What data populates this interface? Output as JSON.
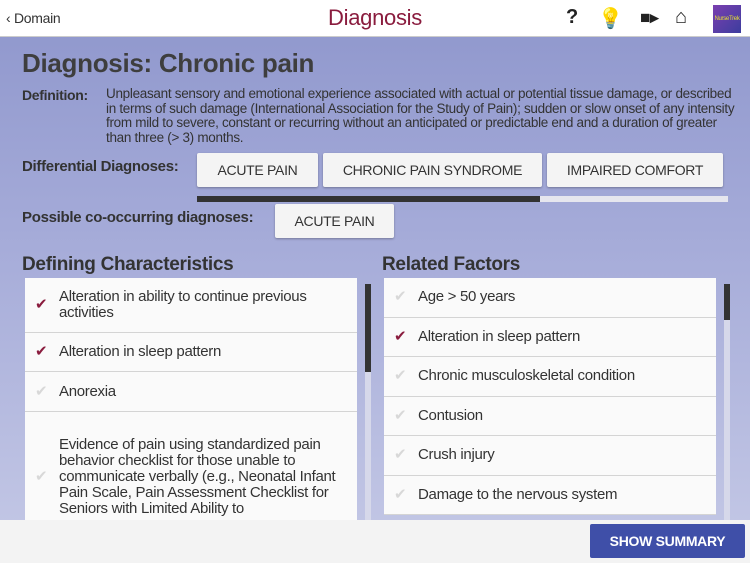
{
  "header": {
    "back_label": "Domain",
    "title": "Diagnosis",
    "icons": [
      "help-icon",
      "lightbulb-icon",
      "video-icon",
      "home-icon",
      "app-logo"
    ],
    "logo_text": "NurseTrek"
  },
  "diagnosis": {
    "title": "Diagnosis: Chronic pain",
    "definition_label": "Definition:",
    "definition": "Unpleasant sensory and emotional experience associated with actual or potential tissue damage, or described in terms of such damage (International Association for the Study of Pain); sudden or slow onset of any intensity from mild to severe, constant or recurring without an anticipated or predictable end and a duration of greater than three (> 3) months."
  },
  "differential": {
    "label": "Differential Diagnoses:",
    "items": [
      "ACUTE PAIN",
      "CHRONIC PAIN SYNDROME",
      "IMPAIRED COMFORT"
    ]
  },
  "cooccurring": {
    "label": "Possible co-occurring diagnoses:",
    "items": [
      "ACUTE PAIN"
    ]
  },
  "defining": {
    "title": "Defining Characteristics",
    "items": [
      {
        "text": "Alteration in ability to continue previous activities",
        "checked": true
      },
      {
        "text": "Alteration in sleep pattern",
        "checked": true
      },
      {
        "text": "Anorexia",
        "checked": false
      },
      {
        "text": "Evidence of pain using standardized pain behavior checklist for those unable to communicate verbally (e.g., Neonatal Infant Pain Scale, Pain Assessment Checklist for Seniors with Limited Ability to",
        "checked": false
      }
    ]
  },
  "related": {
    "title": "Related Factors",
    "items": [
      {
        "text": "Age > 50 years",
        "checked": false
      },
      {
        "text": "Alteration in sleep pattern",
        "checked": true
      },
      {
        "text": "Chronic musculoskeletal condition",
        "checked": false
      },
      {
        "text": "Contusion",
        "checked": false
      },
      {
        "text": "Crush injury",
        "checked": false
      },
      {
        "text": "Damage to the nervous system",
        "checked": false
      }
    ]
  },
  "footer": {
    "show_summary": "SHOW SUMMARY"
  },
  "colors": {
    "accent": "#8a1c3e",
    "button": "#3f4fa8"
  }
}
